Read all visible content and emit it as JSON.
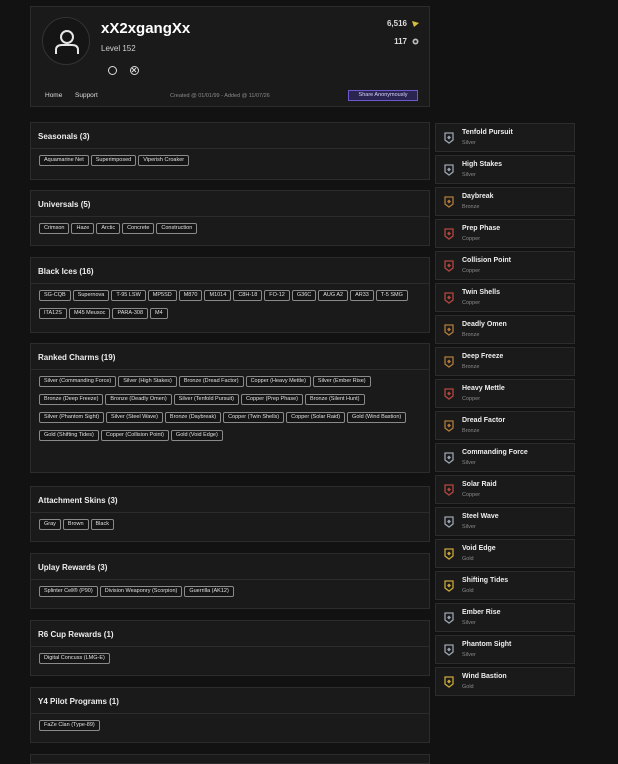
{
  "profile": {
    "username": "xX2xgangXx",
    "level": "Level 152",
    "stat1": "6,516",
    "stat2": "117",
    "nav": [
      "Home",
      "Support"
    ],
    "created": "Created @ 01/01/99 - Added @ 11/07/26",
    "share_label": "Share Anonymously",
    "platforms": [
      "ubisoft-icon",
      "xbox-icon"
    ]
  },
  "sections": [
    {
      "title": "Seasonals (3)",
      "items": [
        "Aquamarine Net",
        "Superimposed",
        "Viperish Croaker"
      ]
    },
    {
      "title": "Universals (5)",
      "items": [
        "Crimson",
        "Haze",
        "Arctic",
        "Concrete",
        "Construction"
      ]
    },
    {
      "title": "Black Ices (16)",
      "items": [
        "SG-CQB",
        "Supernova",
        "T-95 LSW",
        "MP5SD",
        "M870",
        "M1014",
        "C8H-18",
        "FO-12",
        "G36C",
        "AUG A2",
        "AR33",
        "T-5 SMG",
        "ITA12S",
        "M45 Meusoc",
        "PARA-308",
        "M4"
      ]
    },
    {
      "title": "Ranked Charms (19)",
      "items": [
        "Silver (Commanding Force)",
        "Silver (High Stakes)",
        "Bronze (Dread Factor)",
        "Copper (Heavy Mettle)",
        "Silver (Ember Rise)",
        "Bronze (Deep Freeze)",
        "Bronze (Deadly Omen)",
        "Silver (Tenfold Pursuit)",
        "Copper (Prep Phase)",
        "Bronze (Silent Hunt)",
        "Silver (Phantom Sight)",
        "Silver (Steel Wave)",
        "Bronze (Daybreak)",
        "Copper (Twin Shells)",
        "Copper (Solar Raid)",
        "Gold (Wind Bastion)",
        "Gold (Shifting Tides)",
        "Copper (Collision Point)",
        "Gold (Void Edge)"
      ]
    },
    {
      "title": "Attachment Skins (3)",
      "items": [
        "Gray",
        "Brown",
        "Black"
      ]
    },
    {
      "title": "Uplay Rewards (3)",
      "items": [
        "Splinter Cell® (P90)",
        "Division Weaponry (Scorpion)",
        "Guerrilla (AK12)"
      ]
    },
    {
      "title": "R6 Cup Rewards (1)",
      "items": [
        "Digital Concuss (LMG-E)"
      ]
    },
    {
      "title": "Y4 Pilot Programs (1)",
      "items": [
        "FaZe Clan (Type-89)"
      ]
    }
  ],
  "charms": [
    {
      "name": "Tenfold Pursuit",
      "tier": "Silver",
      "color": "#9aa3ad"
    },
    {
      "name": "High Stakes",
      "tier": "Silver",
      "color": "#9aa3ad"
    },
    {
      "name": "Daybreak",
      "tier": "Bronze",
      "color": "#b07a3a"
    },
    {
      "name": "Prep Phase",
      "tier": "Copper",
      "color": "#b2473c"
    },
    {
      "name": "Collision Point",
      "tier": "Copper",
      "color": "#b2473c"
    },
    {
      "name": "Twin Shells",
      "tier": "Copper",
      "color": "#b2473c"
    },
    {
      "name": "Deadly Omen",
      "tier": "Bronze",
      "color": "#b07a3a"
    },
    {
      "name": "Deep Freeze",
      "tier": "Bronze",
      "color": "#b07a3a"
    },
    {
      "name": "Heavy Mettle",
      "tier": "Copper",
      "color": "#b2473c"
    },
    {
      "name": "Dread Factor",
      "tier": "Bronze",
      "color": "#b07a3a"
    },
    {
      "name": "Commanding Force",
      "tier": "Silver",
      "color": "#9aa3ad"
    },
    {
      "name": "Solar Raid",
      "tier": "Copper",
      "color": "#b2473c"
    },
    {
      "name": "Steel Wave",
      "tier": "Silver",
      "color": "#9aa3ad"
    },
    {
      "name": "Void Edge",
      "tier": "Gold",
      "color": "#c9a53a"
    },
    {
      "name": "Shifting Tides",
      "tier": "Gold",
      "color": "#c9a53a"
    },
    {
      "name": "Ember Rise",
      "tier": "Silver",
      "color": "#9aa3ad"
    },
    {
      "name": "Phantom Sight",
      "tier": "Silver",
      "color": "#9aa3ad"
    },
    {
      "name": "Wind Bastion",
      "tier": "Gold",
      "color": "#c9a53a"
    }
  ]
}
